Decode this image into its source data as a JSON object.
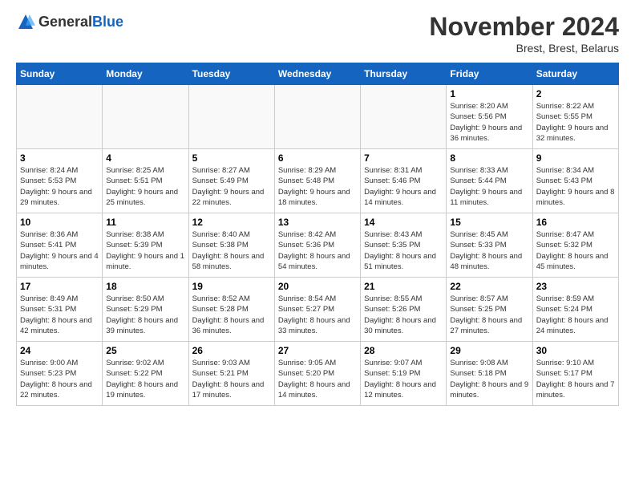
{
  "header": {
    "logo_general": "General",
    "logo_blue": "Blue",
    "month_title": "November 2024",
    "location": "Brest, Brest, Belarus"
  },
  "days_of_week": [
    "Sunday",
    "Monday",
    "Tuesday",
    "Wednesday",
    "Thursday",
    "Friday",
    "Saturday"
  ],
  "weeks": [
    {
      "days": [
        {
          "number": "",
          "info": ""
        },
        {
          "number": "",
          "info": ""
        },
        {
          "number": "",
          "info": ""
        },
        {
          "number": "",
          "info": ""
        },
        {
          "number": "",
          "info": ""
        },
        {
          "number": "1",
          "info": "Sunrise: 8:20 AM\nSunset: 5:56 PM\nDaylight: 9 hours\nand 36 minutes."
        },
        {
          "number": "2",
          "info": "Sunrise: 8:22 AM\nSunset: 5:55 PM\nDaylight: 9 hours\nand 32 minutes."
        }
      ]
    },
    {
      "days": [
        {
          "number": "3",
          "info": "Sunrise: 8:24 AM\nSunset: 5:53 PM\nDaylight: 9 hours\nand 29 minutes."
        },
        {
          "number": "4",
          "info": "Sunrise: 8:25 AM\nSunset: 5:51 PM\nDaylight: 9 hours\nand 25 minutes."
        },
        {
          "number": "5",
          "info": "Sunrise: 8:27 AM\nSunset: 5:49 PM\nDaylight: 9 hours\nand 22 minutes."
        },
        {
          "number": "6",
          "info": "Sunrise: 8:29 AM\nSunset: 5:48 PM\nDaylight: 9 hours\nand 18 minutes."
        },
        {
          "number": "7",
          "info": "Sunrise: 8:31 AM\nSunset: 5:46 PM\nDaylight: 9 hours\nand 14 minutes."
        },
        {
          "number": "8",
          "info": "Sunrise: 8:33 AM\nSunset: 5:44 PM\nDaylight: 9 hours\nand 11 minutes."
        },
        {
          "number": "9",
          "info": "Sunrise: 8:34 AM\nSunset: 5:43 PM\nDaylight: 9 hours\nand 8 minutes."
        }
      ]
    },
    {
      "days": [
        {
          "number": "10",
          "info": "Sunrise: 8:36 AM\nSunset: 5:41 PM\nDaylight: 9 hours\nand 4 minutes."
        },
        {
          "number": "11",
          "info": "Sunrise: 8:38 AM\nSunset: 5:39 PM\nDaylight: 9 hours\nand 1 minute."
        },
        {
          "number": "12",
          "info": "Sunrise: 8:40 AM\nSunset: 5:38 PM\nDaylight: 8 hours\nand 58 minutes."
        },
        {
          "number": "13",
          "info": "Sunrise: 8:42 AM\nSunset: 5:36 PM\nDaylight: 8 hours\nand 54 minutes."
        },
        {
          "number": "14",
          "info": "Sunrise: 8:43 AM\nSunset: 5:35 PM\nDaylight: 8 hours\nand 51 minutes."
        },
        {
          "number": "15",
          "info": "Sunrise: 8:45 AM\nSunset: 5:33 PM\nDaylight: 8 hours\nand 48 minutes."
        },
        {
          "number": "16",
          "info": "Sunrise: 8:47 AM\nSunset: 5:32 PM\nDaylight: 8 hours\nand 45 minutes."
        }
      ]
    },
    {
      "days": [
        {
          "number": "17",
          "info": "Sunrise: 8:49 AM\nSunset: 5:31 PM\nDaylight: 8 hours\nand 42 minutes."
        },
        {
          "number": "18",
          "info": "Sunrise: 8:50 AM\nSunset: 5:29 PM\nDaylight: 8 hours\nand 39 minutes."
        },
        {
          "number": "19",
          "info": "Sunrise: 8:52 AM\nSunset: 5:28 PM\nDaylight: 8 hours\nand 36 minutes."
        },
        {
          "number": "20",
          "info": "Sunrise: 8:54 AM\nSunset: 5:27 PM\nDaylight: 8 hours\nand 33 minutes."
        },
        {
          "number": "21",
          "info": "Sunrise: 8:55 AM\nSunset: 5:26 PM\nDaylight: 8 hours\nand 30 minutes."
        },
        {
          "number": "22",
          "info": "Sunrise: 8:57 AM\nSunset: 5:25 PM\nDaylight: 8 hours\nand 27 minutes."
        },
        {
          "number": "23",
          "info": "Sunrise: 8:59 AM\nSunset: 5:24 PM\nDaylight: 8 hours\nand 24 minutes."
        }
      ]
    },
    {
      "days": [
        {
          "number": "24",
          "info": "Sunrise: 9:00 AM\nSunset: 5:23 PM\nDaylight: 8 hours\nand 22 minutes."
        },
        {
          "number": "25",
          "info": "Sunrise: 9:02 AM\nSunset: 5:22 PM\nDaylight: 8 hours\nand 19 minutes."
        },
        {
          "number": "26",
          "info": "Sunrise: 9:03 AM\nSunset: 5:21 PM\nDaylight: 8 hours\nand 17 minutes."
        },
        {
          "number": "27",
          "info": "Sunrise: 9:05 AM\nSunset: 5:20 PM\nDaylight: 8 hours\nand 14 minutes."
        },
        {
          "number": "28",
          "info": "Sunrise: 9:07 AM\nSunset: 5:19 PM\nDaylight: 8 hours\nand 12 minutes."
        },
        {
          "number": "29",
          "info": "Sunrise: 9:08 AM\nSunset: 5:18 PM\nDaylight: 8 hours\nand 9 minutes."
        },
        {
          "number": "30",
          "info": "Sunrise: 9:10 AM\nSunset: 5:17 PM\nDaylight: 8 hours\nand 7 minutes."
        }
      ]
    }
  ]
}
